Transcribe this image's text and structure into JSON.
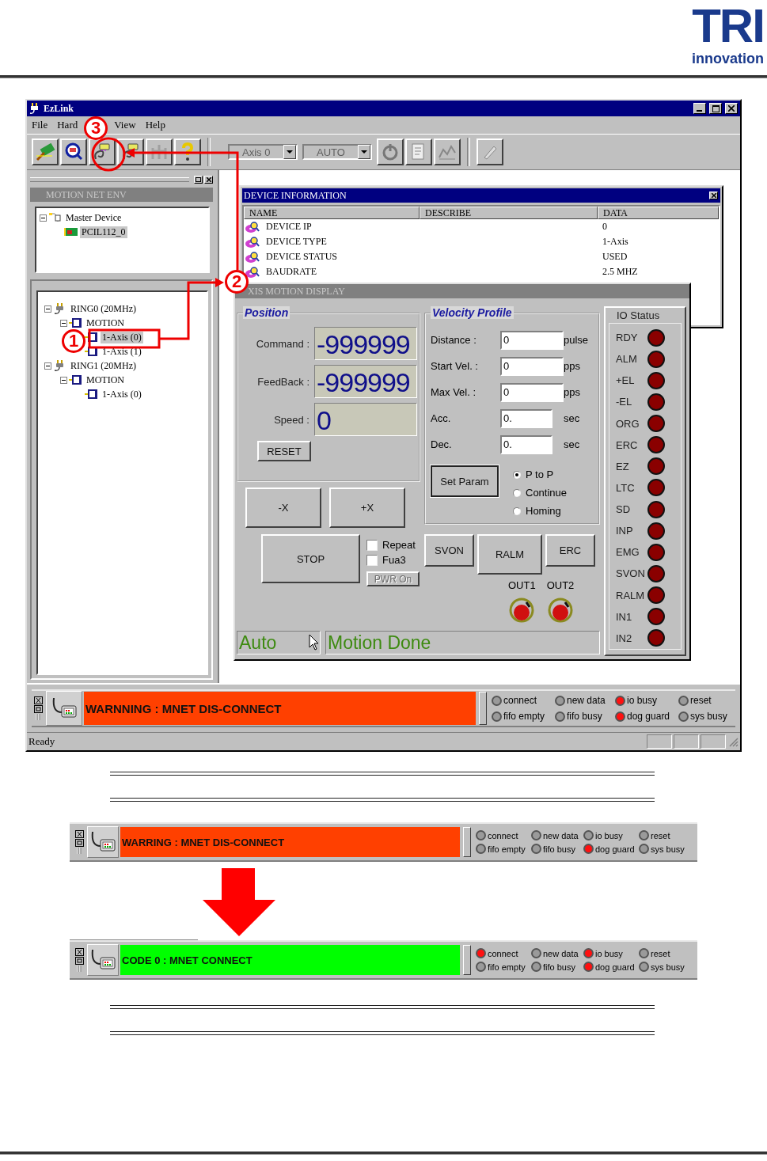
{
  "logo": {
    "wordmark": "TRI",
    "tagline": "innovation"
  },
  "window": {
    "title": "EzLink"
  },
  "menu": [
    {
      "label": "File"
    },
    {
      "label": "Hard"
    },
    {
      "label": "View"
    },
    {
      "label": "Help"
    }
  ],
  "toolbar": {
    "axis_combo": {
      "value": "Axis 0",
      "disabled": true
    },
    "mode_combo": {
      "value": "AUTO",
      "disabled": true
    }
  },
  "env_panel": {
    "title": "MOTION NET ENV",
    "tree": [
      {
        "label": "Master Device",
        "kind": "host",
        "selected": false,
        "expanded": true,
        "children": [
          {
            "label": "PCIL112_0",
            "kind": "card",
            "selected": true
          }
        ]
      }
    ],
    "ring_tree": [
      {
        "label": "RING0 (20MHz)",
        "kind": "ring",
        "selected": false,
        "expanded": true,
        "children": [
          {
            "label": "MOTION",
            "kind": "module",
            "selected": false,
            "expanded": true,
            "children": [
              {
                "label": "1-Axis (0)",
                "kind": "axis",
                "selected": true
              },
              {
                "label": "1-Axis (1)",
                "kind": "axis",
                "selected": false
              }
            ]
          }
        ]
      },
      {
        "label": "RING1 (20MHz)",
        "kind": "ring",
        "selected": false,
        "expanded": true,
        "children": [
          {
            "label": "MOTION",
            "kind": "module",
            "selected": false,
            "expanded": true,
            "children": [
              {
                "label": "1-Axis (0)",
                "kind": "axis",
                "selected": false
              }
            ]
          }
        ]
      }
    ]
  },
  "device_info": {
    "title": "DEVICE INFORMATION",
    "columns": [
      "NAME",
      "DESCRIBE",
      "DATA"
    ],
    "rows": [
      {
        "name": "DEVICE IP",
        "data": "0"
      },
      {
        "name": "DEVICE TYPE",
        "data": "1-Axis"
      },
      {
        "name": "DEVICE STATUS",
        "data": "USED"
      },
      {
        "name": "BAUDRATE",
        "data": "2.5 MHZ"
      }
    ]
  },
  "axis_display": {
    "title": "XIS MOTION DISPLAY",
    "position": {
      "title": "Position",
      "command_label": "Command :",
      "command": "-999999",
      "feedback_label": "FeedBack :",
      "feedback": "-999999",
      "speed_label": "Speed :",
      "speed": "0",
      "reset": "RESET"
    },
    "velocity": {
      "title": "Velocity Profile",
      "fields": [
        {
          "label": "Distance :",
          "value": "0",
          "unit": "pulse"
        },
        {
          "label": "Start Vel. :",
          "value": "0",
          "unit": "pps"
        },
        {
          "label": "Max Vel. :",
          "value": "0",
          "unit": "pps"
        },
        {
          "label": "Acc.",
          "value": "0.",
          "unit": "sec"
        },
        {
          "label": "Dec.",
          "value": "0.",
          "unit": "sec"
        }
      ],
      "set_param": "Set Param",
      "modes": [
        {
          "label": "P to P",
          "selected": true
        },
        {
          "label": "Continue",
          "selected": false
        },
        {
          "label": "Homing",
          "selected": false
        }
      ]
    },
    "jog_buttons": [
      "-X",
      "+X"
    ],
    "stop": "STOP",
    "options": [
      {
        "label": "Repeat",
        "checked": false
      },
      {
        "label": "Fua3",
        "checked": false
      }
    ],
    "pwr_button": {
      "label": "PWR On",
      "disabled": true
    },
    "servo_buttons": [
      "SVON",
      "RALM",
      "ERC"
    ],
    "outputs": [
      {
        "label": "OUT1",
        "on": false
      },
      {
        "label": "OUT2",
        "on": false
      }
    ],
    "mode_text": "Auto",
    "status_text": "Motion Done",
    "io_status": {
      "title": "IO Status",
      "signals": [
        {
          "label": "RDY",
          "on": false
        },
        {
          "label": "ALM",
          "on": false
        },
        {
          "label": "+EL",
          "on": false
        },
        {
          "label": "-EL",
          "on": false
        },
        {
          "label": "ORG",
          "on": false
        },
        {
          "label": "ERC",
          "on": false
        },
        {
          "label": "EZ",
          "on": false
        },
        {
          "label": "LTC",
          "on": false
        },
        {
          "label": "SD",
          "on": false
        },
        {
          "label": "INP",
          "on": false
        },
        {
          "label": "EMG",
          "on": false
        },
        {
          "label": "SVON",
          "on": false
        },
        {
          "label": "RALM",
          "on": false
        },
        {
          "label": "IN1",
          "on": false
        },
        {
          "label": "IN2",
          "on": false
        }
      ]
    }
  },
  "status_panel": {
    "kind": "error",
    "message": "WARNNING : MNET DIS-CONNECT",
    "leds": [
      {
        "label": "connect",
        "on": false
      },
      {
        "label": "new data",
        "on": false
      },
      {
        "label": "io busy",
        "on": true
      },
      {
        "label": "reset",
        "on": false
      },
      {
        "label": "fifo empty",
        "on": false
      },
      {
        "label": "fifo busy",
        "on": false
      },
      {
        "label": "dog guard",
        "on": true
      },
      {
        "label": "sys busy",
        "on": false
      }
    ]
  },
  "status_bar": {
    "text": "Ready"
  },
  "callouts": [
    "1",
    "2",
    "3"
  ],
  "comparison": {
    "before": {
      "kind": "error",
      "message": "WARRING : MNET DIS-CONNECT",
      "leds": [
        {
          "label": "connect",
          "on": false
        },
        {
          "label": "new data",
          "on": false
        },
        {
          "label": "io busy",
          "on": false
        },
        {
          "label": "reset",
          "on": false
        },
        {
          "label": "fifo empty",
          "on": false
        },
        {
          "label": "fifo busy",
          "on": false
        },
        {
          "label": "dog guard",
          "on": true
        },
        {
          "label": "sys busy",
          "on": false
        }
      ]
    },
    "after": {
      "kind": "ok",
      "message": "CODE 0 : MNET CONNECT",
      "leds": [
        {
          "label": "connect",
          "on": true
        },
        {
          "label": "new data",
          "on": false
        },
        {
          "label": "io busy",
          "on": true
        },
        {
          "label": "reset",
          "on": false
        },
        {
          "label": "fifo empty",
          "on": false
        },
        {
          "label": "fifo busy",
          "on": false
        },
        {
          "label": "dog guard",
          "on": true
        },
        {
          "label": "sys busy",
          "on": false
        }
      ]
    }
  }
}
